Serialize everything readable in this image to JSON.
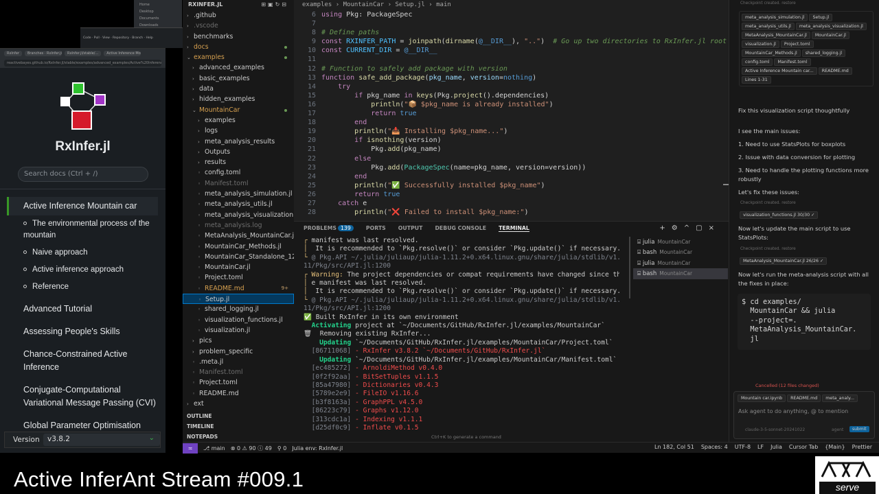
{
  "docs": {
    "brand": "RxInfer.jl",
    "search_placeholder": "Search docs (Ctrl + /)",
    "browser_tabs": [
      "RxInfer",
      "Branches · RxInfer.jl",
      "RxInfer.jl/stable/...",
      "Active Inference Mountain"
    ],
    "url": "reactivebayes.github.io/RxInfer.jl/stable/examples/advanced_examples/Active%20Inference%20Mountain%20car/",
    "nav": [
      {
        "label": "Active Inference Mountain car",
        "active": true
      },
      {
        "label": "The environmental process of the mountain",
        "sub": true
      },
      {
        "label": "Naive approach",
        "sub": true
      },
      {
        "label": "Active inference approach",
        "sub": true
      },
      {
        "label": "Reference",
        "sub": true
      },
      {
        "label": "Advanced Tutorial"
      },
      {
        "label": "Assessing People's Skills"
      },
      {
        "label": "Chance-Constrained Active Inference"
      },
      {
        "label": "Conjugate-Computational Variational Message Passing (CVI)"
      },
      {
        "label": "Global Parameter Optimisation"
      }
    ],
    "version_label": "Version",
    "version_value": "v3.8.2"
  },
  "explorer": {
    "title": "RXINFER.JL",
    "toolbar_icons": [
      "new-file-icon",
      "new-folder-icon",
      "refresh-icon",
      "collapse-icon"
    ],
    "items": [
      {
        "label": ".github",
        "kind": "folder",
        "indent": 0
      },
      {
        "label": ".vscode",
        "kind": "folder",
        "indent": 0,
        "dim": true
      },
      {
        "label": "benchmarks",
        "kind": "folder",
        "indent": 0
      },
      {
        "label": "docs",
        "kind": "folder",
        "indent": 0,
        "color": "orange",
        "dot": true
      },
      {
        "label": "examples",
        "kind": "folder-open",
        "indent": 0,
        "color": "orange",
        "dot": true
      },
      {
        "label": "advanced_examples",
        "kind": "folder",
        "indent": 1
      },
      {
        "label": "basic_examples",
        "kind": "folder",
        "indent": 1
      },
      {
        "label": "data",
        "kind": "folder",
        "indent": 1
      },
      {
        "label": "hidden_examples",
        "kind": "folder",
        "indent": 1
      },
      {
        "label": "MountainCar",
        "kind": "folder-open",
        "indent": 1,
        "color": "orange",
        "dot": true
      },
      {
        "label": "examples",
        "kind": "folder",
        "indent": 2
      },
      {
        "label": "logs",
        "kind": "folder",
        "indent": 2
      },
      {
        "label": "meta_analysis_results",
        "kind": "folder",
        "indent": 2
      },
      {
        "label": "Outputs",
        "kind": "folder",
        "indent": 2
      },
      {
        "label": "results",
        "kind": "folder",
        "indent": 2
      },
      {
        "label": "config.toml",
        "kind": "file",
        "indent": 2
      },
      {
        "label": "Manifest.toml",
        "kind": "file",
        "indent": 2,
        "dim": true
      },
      {
        "label": "meta_analysis_simulation.jl",
        "kind": "file",
        "indent": 2
      },
      {
        "label": "meta_analysis_utils.jl",
        "kind": "file",
        "indent": 2
      },
      {
        "label": "meta_analysis_visualization.jl",
        "kind": "file",
        "indent": 2
      },
      {
        "label": "meta_analysis.log",
        "kind": "file",
        "indent": 2,
        "dim": true
      },
      {
        "label": "MetaAnalysis_MountainCar.jl",
        "kind": "file",
        "indent": 2
      },
      {
        "label": "MountainCar_Methods.jl",
        "kind": "file",
        "indent": 2
      },
      {
        "label": "MountainCar_Standalone_12-2...",
        "kind": "file",
        "indent": 2
      },
      {
        "label": "MountainCar.jl",
        "kind": "file",
        "indent": 2
      },
      {
        "label": "Project.toml",
        "kind": "file",
        "indent": 2
      },
      {
        "label": "README.md",
        "kind": "file",
        "indent": 2,
        "color": "orange",
        "badge": "9+"
      },
      {
        "label": "Setup.jl",
        "kind": "file",
        "indent": 2,
        "selected": true
      },
      {
        "label": "shared_logging.jl",
        "kind": "file",
        "indent": 2
      },
      {
        "label": "visualization_functions.jl",
        "kind": "file",
        "indent": 2
      },
      {
        "label": "visualization.jl",
        "kind": "file",
        "indent": 2
      },
      {
        "label": "pics",
        "kind": "folder",
        "indent": 1
      },
      {
        "label": "problem_specific",
        "kind": "folder",
        "indent": 1
      },
      {
        "label": ".meta.jl",
        "kind": "file",
        "indent": 1
      },
      {
        "label": "Manifest.toml",
        "kind": "file",
        "indent": 1,
        "dim": true
      },
      {
        "label": "Project.toml",
        "kind": "file",
        "indent": 1
      },
      {
        "label": "README.md",
        "kind": "file",
        "indent": 1
      },
      {
        "label": "ext",
        "kind": "folder",
        "indent": 0
      }
    ],
    "sections": [
      "OUTLINE",
      "TIMELINE",
      "NOTEPADS"
    ]
  },
  "editor": {
    "breadcrumb": [
      "examples",
      "MountainCar",
      "Setup.jl",
      "main"
    ],
    "lines": [
      {
        "n": "6",
        "html": "<span class=\"kw\">using</span> Pkg: PackageSpec"
      },
      {
        "n": "7",
        "html": ""
      },
      {
        "n": "8",
        "html": "<span class=\"cm\"># Define paths</span>"
      },
      {
        "n": "9",
        "html": "<span class=\"kw\">const</span> <span class=\"cn\">RXINFER_PATH</span> = <span class=\"fn\">joinpath</span>(<span class=\"fn\">dirname</span>(<span class=\"bl\">@__DIR__</span>), <span class=\"st\">\"..\"</span>)  <span class=\"cm\"># Go up two directories to RxInfer.jl root</span>"
      },
      {
        "n": "10",
        "html": "<span class=\"kw\">const</span> <span class=\"cn\">CURRENT_DIR</span> = <span class=\"bl\">@__DIR__</span>"
      },
      {
        "n": "11",
        "html": ""
      },
      {
        "n": "12",
        "html": "<span class=\"cm\"># Function to safely add package with version</span>"
      },
      {
        "n": "13",
        "html": "<span class=\"kw\">function</span> <span class=\"fn\">safe_add_package</span>(<span class=\"pm\">pkg_name</span>, <span class=\"pm\">version</span>=<span class=\"bl\">nothing</span>)"
      },
      {
        "n": "14",
        "html": "    <span class=\"kw\">try</span>"
      },
      {
        "n": "15",
        "html": "        <span class=\"kw\">if</span> pkg_name <span class=\"kw\">in</span> <span class=\"fn\">keys</span>(Pkg.<span class=\"fn\">project</span>().dependencies)"
      },
      {
        "n": "16",
        "html": "            <span class=\"fn\">println</span>(<span class=\"st\">\"📦 $pkg_name is already installed\"</span>)"
      },
      {
        "n": "17",
        "html": "            <span class=\"kw\">return</span> <span class=\"bl\">true</span>"
      },
      {
        "n": "18",
        "html": "        <span class=\"kw\">end</span>"
      },
      {
        "n": "19",
        "html": "        <span class=\"fn\">println</span>(<span class=\"st\">\"📥 Installing $pkg_name...\"</span>)"
      },
      {
        "n": "20",
        "html": "        <span class=\"kw\">if</span> <span class=\"fn\">isnothing</span>(version)"
      },
      {
        "n": "21",
        "html": "            Pkg.<span class=\"fn\">add</span>(pkg_name)"
      },
      {
        "n": "22",
        "html": "        <span class=\"kw\">else</span>"
      },
      {
        "n": "23",
        "html": "            Pkg.<span class=\"fn\">add</span>(<span class=\"ty\">PackageSpec</span>(name=pkg_name, version=version))"
      },
      {
        "n": "24",
        "html": "        <span class=\"kw\">end</span>"
      },
      {
        "n": "25",
        "html": "        <span class=\"fn\">println</span>(<span class=\"st\">\"✅ Successfully installed $pkg_name\"</span>)"
      },
      {
        "n": "26",
        "html": "        <span class=\"kw\">return</span> <span class=\"bl\">true</span>"
      },
      {
        "n": "27",
        "html": "    <span class=\"kw\">catch</span> e"
      },
      {
        "n": "28",
        "html": "        <span class=\"fn\">println</span>(<span class=\"st\">\"❌ Failed to install $pkg_name:\"</span>)"
      }
    ]
  },
  "panel": {
    "tabs": [
      "PROBLEMS",
      "PORTS",
      "OUTPUT",
      "DEBUG CONSOLE",
      "TERMINAL"
    ],
    "problems_count": "139",
    "active_tab": "TERMINAL",
    "terminal_html": [
      "<span class=\"y\">┌</span> manifest was last resolved.",
      "<span class=\"y\">│</span>  It is recommended to `Pkg.resolve()` or consider `Pkg.update()` if necessary.",
      "<span class=\"y\">└</span> <span class=\"gr\">@ Pkg.API ~/.julia/juliaup/julia-1.11.2+0.x64.linux.gnu/share/julia/stdlib/v1.</span>",
      "<span class=\"gr\">11/Pkg/src/API.jl:1200</span>",
      "<span class=\"y\">┌ Warning:</span> The project dependencies or compat requirements have changed since th",
      "<span class=\"y\">│</span> e manifest was last resolved.",
      "<span class=\"y\">│</span>  It is recommended to `Pkg.resolve()` or consider `Pkg.update()` if necessary.",
      "<span class=\"y\">└</span> <span class=\"gr\">@ Pkg.API ~/.julia/juliaup/julia-1.11.2+0.x64.linux.gnu/share/julia/stdlib/v1.</span>",
      "<span class=\"gr\">11/Pkg/src/API.jl:1200</span>",
      "✅ Built RxInfer in its own environment",
      "  <span class=\"gb\">Activating</span> project at `~/Documents/GitHub/RxInfer.jl/examples/MountainCar`",
      "🗑  Removing existing RxInfer...",
      "    <span class=\"gb\">Updating</span> `~/Documents/GitHub/RxInfer.jl/examples/MountainCar/Project.toml`",
      "  <span class=\"gr\">[86711068]</span> <span class=\"r\">- RxInfer v3.8.2 `~/Documents/GitHub/RxInfer.jl`</span>",
      "    <span class=\"gb\">Updating</span> `~/Documents/GitHub/RxInfer.jl/examples/MountainCar/Manifest.toml`",
      "  <span class=\"gr\">[ec485272]</span> <span class=\"r\">- ArnoldiMethod v0.4.0</span>",
      "  <span class=\"gr\">[0f2f92aa]</span> <span class=\"r\">- BitSetTuples v1.1.5</span>",
      "  <span class=\"gr\">[85a47980]</span> <span class=\"r\">- Dictionaries v0.4.3</span>",
      "  <span class=\"gr\">[5789e2e9]</span> <span class=\"r\">- FileIO v1.16.6</span>",
      "  <span class=\"gr\">[b3f8163a]</span> <span class=\"r\">- GraphPPL v4.5.0</span>",
      "  <span class=\"gr\">[86223c79]</span> <span class=\"r\">- Graphs v1.12.0</span>",
      "  <span class=\"gr\">[313cdc1a]</span> <span class=\"r\">- Indexing v1.1.1</span>",
      "  <span class=\"gr\">[d25df0c9]</span> <span class=\"r\">- Inflate v0.1.5</span>"
    ],
    "terminals": [
      {
        "shell": "julia",
        "name": "MountainCar"
      },
      {
        "shell": "bash",
        "name": "MountainCar"
      },
      {
        "shell": "julia",
        "name": "MountainCar"
      },
      {
        "shell": "bash",
        "name": "MountainCar",
        "active": true
      }
    ],
    "hint": "Ctrl+K to generate a command"
  },
  "chat": {
    "checkpoint_top": "Checkpoint created. restore",
    "context_chips": [
      "meta_analysis_simulation.jl",
      "Setup.jl",
      "meta_analysis_utils.jl",
      "meta_analysis_visualization.jl",
      "MetaAnalysis_MountainCar.jl",
      "MountainCar.jl",
      "visualization.jl",
      "Project.toml",
      "MountainCar_Methods.jl",
      "shared_logging.jl",
      "config.toml",
      "Manifest.toml",
      "Active Inference Mountain car...",
      "README.md",
      "Lines 1-31"
    ],
    "user_msg": "Fix this visualization script thoughtfully",
    "intro": "I see the main issues:",
    "issues": [
      "1. Need to use StatsPlots for boxplots",
      "2. Issue with data conversion for plotting",
      "3. Need to handle the plotting functions more robustly"
    ],
    "fix_line": "Let's fix these issues:",
    "checkpoint": "Checkpoint created. restore",
    "file_chip_1": "visualization_functions.jl 30/30 ✓",
    "update_line": "Now let's update the main script to use StatsPlots:",
    "file_chip_2": "MetaAnalysis_MountainCar.jl 26/26 ✓",
    "run_line": "Now let's run the meta-analysis script with all the fixes in place:",
    "command": "$ cd examples/\n  MountainCar && julia\n  --project=.\n  MetaAnalysis_MountainCar.\n  jl",
    "cancelled": "Cancelled (12 files changed)",
    "input_chips": [
      "Mountain car.ipynb",
      "README.md",
      "meta_analy..."
    ],
    "input_placeholder": "Ask agent to do anything, @ to mention",
    "model": "claude-3-5-sonnet-20241022",
    "mode": "agent",
    "submit": "submit"
  },
  "status": {
    "branch": "main",
    "problems": "⊗ 0 ⚠ 90 ⓘ 49",
    "ports": "0",
    "env": "Julia env: RxInfer.jl",
    "right": [
      "Ln 182, Col 51",
      "Spaces: 4",
      "UTF-8",
      "LF",
      "Julia",
      "Cursor Tab",
      "{Main}",
      "Prettier"
    ]
  },
  "caption": "Active InferAnt Stream #009.1",
  "brand_logo_text": "serve"
}
